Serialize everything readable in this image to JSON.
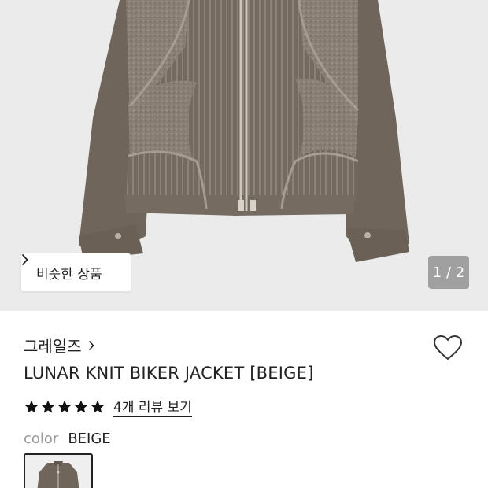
{
  "product_image": {
    "similar_button_label": "비슷한 상품",
    "pager_text": "1 / 2"
  },
  "brand": {
    "name": "그레일즈"
  },
  "product": {
    "title": "LUNAR KNIT BIKER JACKET [BEIGE]",
    "rating_stars": 5,
    "review_link_text": "4개 리뷰 보기",
    "color_label": "color",
    "color_value": "BEIGE"
  },
  "colors": {
    "hero_background": "#ebebeb",
    "jacket": "#6e645a",
    "pager_background": "#a0a0a0"
  },
  "icons": {
    "chevron": "chevron-right-icon",
    "heart": "heart-outline-icon",
    "star": "star-icon"
  }
}
